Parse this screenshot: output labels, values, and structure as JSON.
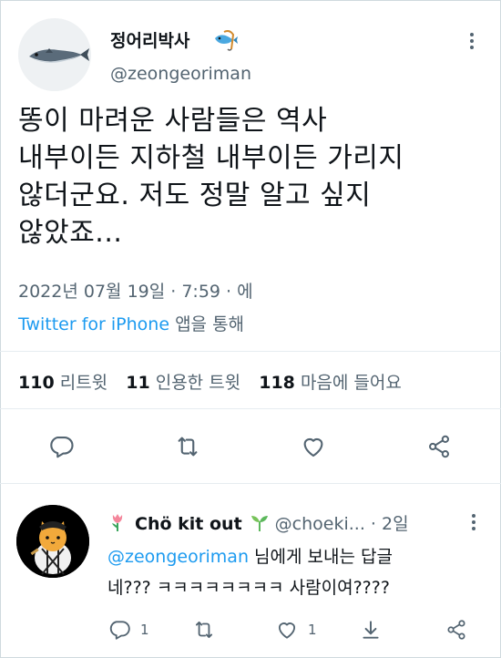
{
  "tweet": {
    "display_name": "정어리박사",
    "handle": "@zeongeoriman",
    "lines": [
      "똥이 마려운 사람들은 역사",
      "내부이든 지하철 내부이든 가리지",
      "않더군요. 저도 정말 알고 싶지",
      "않았죠..."
    ],
    "date": "2022년 07월 19일 · 7:59 · 에",
    "source": "Twitter for iPhone",
    "source_suffix": " 앱을 통해",
    "stats": {
      "retweets_count": "110",
      "retweets_label": "리트윗",
      "quotes_count": "11",
      "quotes_label": "인용한 트윗",
      "likes_count": "118",
      "likes_label": "마음에 들어요"
    }
  },
  "reply": {
    "display_name": "Chö kit out",
    "handle": "@choeki...",
    "time": "· 2일",
    "replying_to": "@zeongeoriman",
    "replying_suffix": " 님에게 보내는 답글",
    "text": "네??? ㅋㅋㅋㅋㅋㅋㅋㅋ 사람이여????",
    "reply_count": "1",
    "like_count": "1"
  },
  "colors": {
    "accent": "#1d9bf0",
    "secondary_text": "#536471",
    "primary_text": "#0f1419"
  },
  "icons": [
    "more-icon",
    "reply-icon",
    "retweet-icon",
    "like-icon",
    "share-icon",
    "fish-icon",
    "tulip-icon",
    "sprout-icon",
    "download-icon"
  ]
}
